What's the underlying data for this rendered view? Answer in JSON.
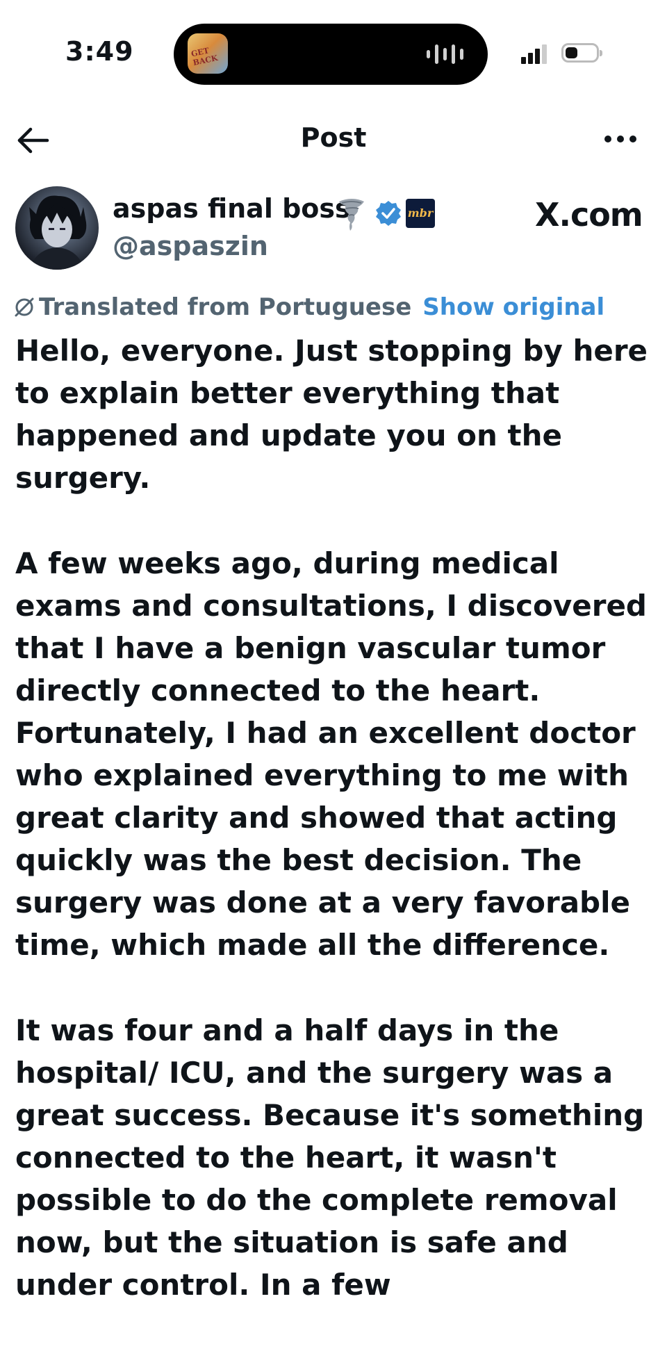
{
  "status_bar": {
    "time": "3:49",
    "now_playing_art_text": "GET BACK"
  },
  "nav": {
    "title": "Post"
  },
  "author": {
    "display_name": "aspas final boss",
    "handle": "@aspaszin",
    "affiliate_badge": "mbr"
  },
  "watermark": "X.com",
  "translation": {
    "label": "Translated from Portuguese",
    "show_original": "Show original"
  },
  "post": {
    "paragraphs": [
      "Hello, everyone. Just stopping by here to explain better everything that happened and update you on the surgery.",
      "A few weeks ago, during medical exams and consultations, I discovered that I have a benign vascular tumor directly connected to the heart. Fortunately, I had an excellent doctor who explained everything to me with great clarity and showed that acting quickly was the best decision. The surgery was done at a very favorable time, which made all the difference.",
      "It was four and a half days in the hospital/ ICU, and the surgery was a great success. Because it's something connected to the heart, it wasn't possible to do the complete removal now, but the situation is safe and under control. In a few"
    ]
  },
  "colors": {
    "text": "#0f1419",
    "secondary": "#536471",
    "link": "#3b8ed6",
    "verified": "#3b8ed6"
  },
  "icons": [
    "back-arrow-icon",
    "more-icon",
    "tornado-icon",
    "verified-icon",
    "translate-icon",
    "signal-icon",
    "battery-icon"
  ]
}
